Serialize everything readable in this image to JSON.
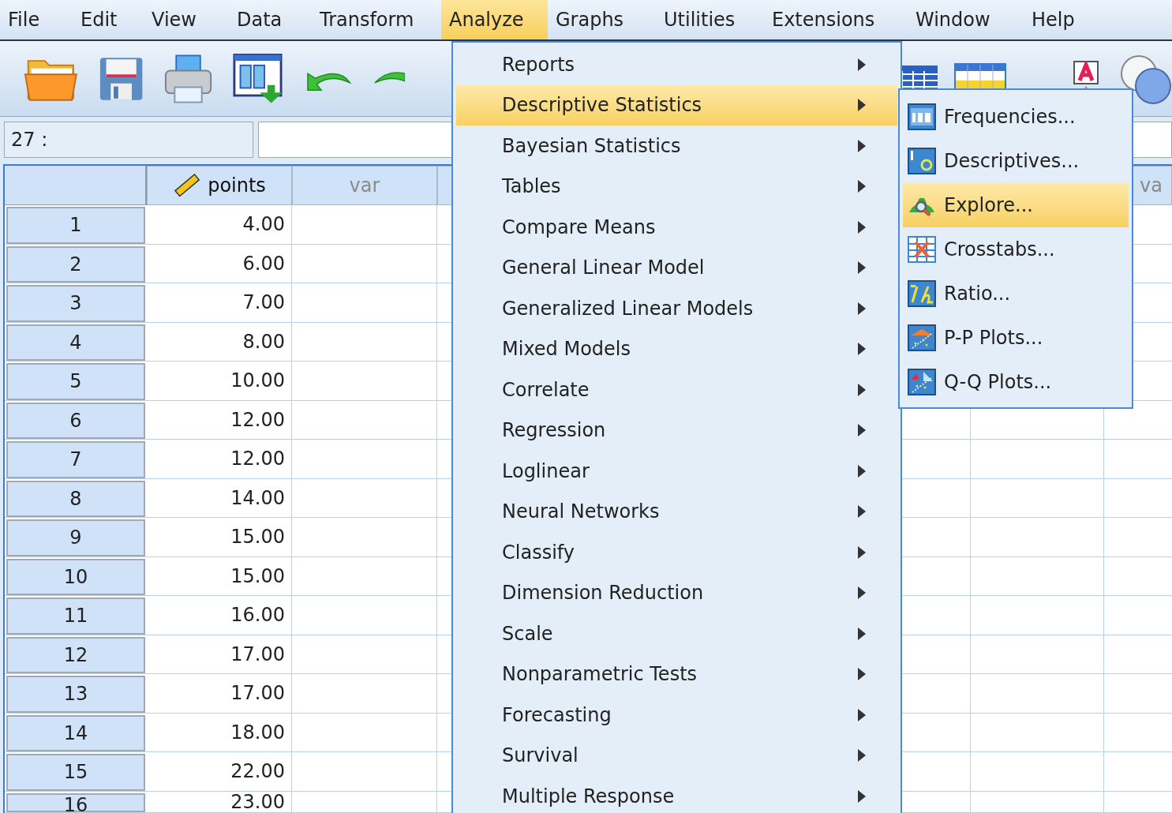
{
  "menu_bar": [
    {
      "label": "File",
      "selected": false
    },
    {
      "label": "Edit",
      "selected": false
    },
    {
      "label": "View",
      "selected": false
    },
    {
      "label": "Data",
      "selected": false
    },
    {
      "label": "Transform",
      "selected": false
    },
    {
      "label": "Analyze",
      "selected": true
    },
    {
      "label": "Graphs",
      "selected": false
    },
    {
      "label": "Utilities",
      "selected": false
    },
    {
      "label": "Extensions",
      "selected": false
    },
    {
      "label": "Window",
      "selected": false
    },
    {
      "label": "Help",
      "selected": false
    }
  ],
  "cell_reference": "27 :",
  "grid": {
    "columns": [
      {
        "label": "points",
        "kind": "scale"
      },
      {
        "label": "var",
        "kind": "empty"
      }
    ],
    "far_right_column": {
      "label": "va",
      "kind": "empty"
    },
    "rows": [
      {
        "row": "1",
        "points": "4.00"
      },
      {
        "row": "2",
        "points": "6.00"
      },
      {
        "row": "3",
        "points": "7.00"
      },
      {
        "row": "4",
        "points": "8.00"
      },
      {
        "row": "5",
        "points": "10.00"
      },
      {
        "row": "6",
        "points": "12.00"
      },
      {
        "row": "7",
        "points": "12.00"
      },
      {
        "row": "8",
        "points": "14.00"
      },
      {
        "row": "9",
        "points": "15.00"
      },
      {
        "row": "10",
        "points": "15.00"
      },
      {
        "row": "11",
        "points": "16.00"
      },
      {
        "row": "12",
        "points": "17.00"
      },
      {
        "row": "13",
        "points": "17.00"
      },
      {
        "row": "14",
        "points": "18.00"
      },
      {
        "row": "15",
        "points": "22.00"
      },
      {
        "row": "16",
        "points": "23.00"
      }
    ]
  },
  "analyze_menu": [
    {
      "label": "Reports",
      "selected": false
    },
    {
      "label": "Descriptive Statistics",
      "selected": true
    },
    {
      "label": "Bayesian Statistics",
      "selected": false
    },
    {
      "label": "Tables",
      "selected": false
    },
    {
      "label": "Compare Means",
      "selected": false
    },
    {
      "label": "General Linear Model",
      "selected": false
    },
    {
      "label": "Generalized Linear Models",
      "selected": false
    },
    {
      "label": "Mixed Models",
      "selected": false
    },
    {
      "label": "Correlate",
      "selected": false
    },
    {
      "label": "Regression",
      "selected": false
    },
    {
      "label": "Loglinear",
      "selected": false
    },
    {
      "label": "Neural Networks",
      "selected": false
    },
    {
      "label": "Classify",
      "selected": false
    },
    {
      "label": "Dimension Reduction",
      "selected": false
    },
    {
      "label": "Scale",
      "selected": false
    },
    {
      "label": "Nonparametric Tests",
      "selected": false
    },
    {
      "label": "Forecasting",
      "selected": false
    },
    {
      "label": "Survival",
      "selected": false
    },
    {
      "label": "Multiple Response",
      "selected": false
    }
  ],
  "descriptive_statistics_submenu": [
    {
      "label": "Frequencies...",
      "selected": false,
      "kind": "frequencies"
    },
    {
      "label": "Descriptives...",
      "selected": false,
      "kind": "descriptives"
    },
    {
      "label": "Explore...",
      "selected": true,
      "kind": "explore"
    },
    {
      "label": "Crosstabs...",
      "selected": false,
      "kind": "crosstabs"
    },
    {
      "label": "Ratio...",
      "selected": false,
      "kind": "ratio"
    },
    {
      "label": "P-P Plots...",
      "selected": false,
      "kind": "pp"
    },
    {
      "label": "Q-Q Plots...",
      "selected": false,
      "kind": "qq"
    }
  ]
}
